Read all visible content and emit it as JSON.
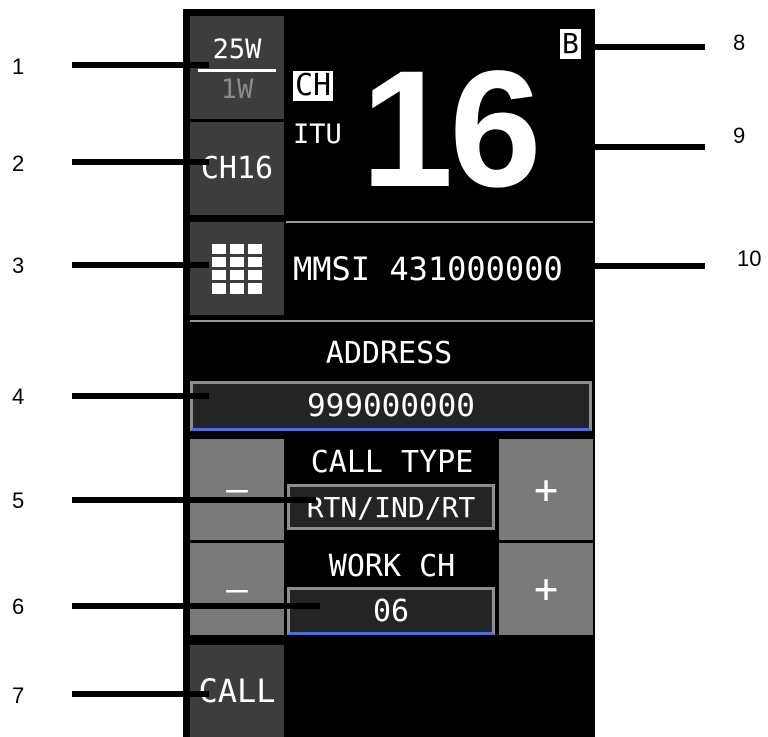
{
  "callouts": {
    "c1": "1",
    "c2": "2",
    "c3": "3",
    "c4": "4",
    "c5": "5",
    "c6": "6",
    "c7": "7",
    "c8": "8",
    "c9": "9",
    "c10": "10"
  },
  "power": {
    "high": "25W",
    "low": "1W"
  },
  "channel": {
    "prefix": "CH",
    "mode": "ITU",
    "number": "16",
    "bank": "B",
    "quick_button": "CH16"
  },
  "mmsi": {
    "text": "MMSI 431000000"
  },
  "address": {
    "label": "ADDRESS",
    "value": "999000000"
  },
  "call_type": {
    "label": "CALL TYPE",
    "value": "RTN/IND/RT",
    "minus": "—",
    "plus": "+"
  },
  "work_ch": {
    "label": "WORK CH",
    "value": "06",
    "minus": "—",
    "plus": "+"
  },
  "call_button": "CALL",
  "icons": {
    "keypad": "grid-keypad-icon"
  },
  "colors": {
    "panel_bg": "#000000",
    "button_bg": "#3d3d3d",
    "plus_minus_bg": "#7a7a7a",
    "field_underline": "#3b6fff",
    "inactive_text": "#8a8a8a"
  }
}
